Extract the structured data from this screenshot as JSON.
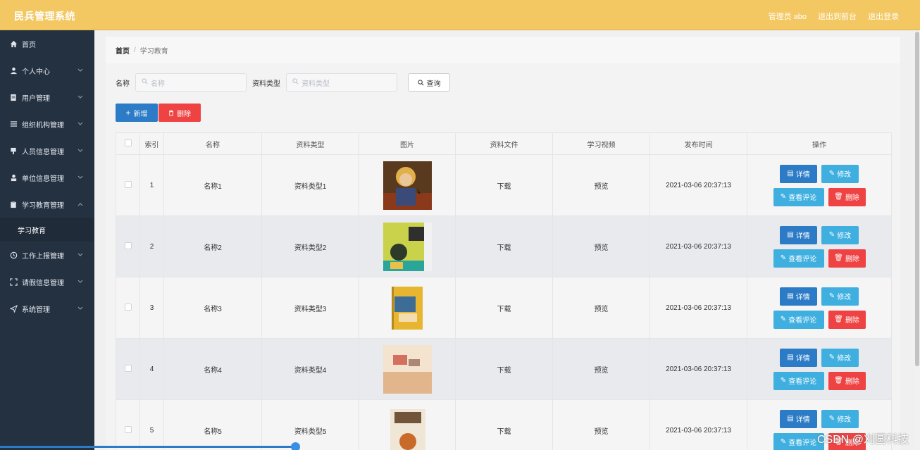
{
  "app": {
    "title": "民兵管理系统"
  },
  "topnav": {
    "admin": "管理员 abo",
    "back": "退出到前台",
    "logout": "退出登录"
  },
  "sidebar": {
    "items": [
      {
        "label": "首页",
        "icon": "home-icon"
      },
      {
        "label": "个人中心",
        "icon": "user-icon"
      },
      {
        "label": "用户管理",
        "icon": "document-icon"
      },
      {
        "label": "组织机构管理",
        "icon": "list-icon"
      },
      {
        "label": "人员信息管理",
        "icon": "badge-icon"
      },
      {
        "label": "单位信息管理",
        "icon": "person-icon"
      },
      {
        "label": "学习教育管理",
        "icon": "clipboard-icon"
      },
      {
        "label": "工作上报管理",
        "icon": "clock-icon"
      },
      {
        "label": "请假信息管理",
        "icon": "frame-icon"
      },
      {
        "label": "系统管理",
        "icon": "send-icon"
      }
    ],
    "sub_active": "学习教育"
  },
  "breadcrumb": {
    "home": "首页",
    "sep": "/",
    "current": "学习教育"
  },
  "filters": {
    "name_label": "名称",
    "name_placeholder": "名称",
    "type_label": "资料类型",
    "type_placeholder": "资料类型",
    "query": "查询"
  },
  "actions": {
    "add": "新增",
    "delete": "删除"
  },
  "table": {
    "headers": [
      "索引",
      "名称",
      "资料类型",
      "图片",
      "资料文件",
      "学习视频",
      "发布时间",
      "操作"
    ],
    "rows": [
      {
        "index": "1",
        "name": "名称1",
        "type": "资料类型1",
        "file": "下载",
        "video": "预览",
        "time": "2021-03-06 20:37:13"
      },
      {
        "index": "2",
        "name": "名称2",
        "type": "资料类型2",
        "file": "下载",
        "video": "预览",
        "time": "2021-03-06 20:37:13"
      },
      {
        "index": "3",
        "name": "名称3",
        "type": "资料类型3",
        "file": "下载",
        "video": "预览",
        "time": "2021-03-06 20:37:13"
      },
      {
        "index": "4",
        "name": "名称4",
        "type": "资料类型4",
        "file": "下载",
        "video": "预览",
        "time": "2021-03-06 20:37:13"
      },
      {
        "index": "5",
        "name": "名称5",
        "type": "资料类型5",
        "file": "下载",
        "video": "预览",
        "time": "2021-03-06 20:37:13"
      }
    ],
    "op_labels": {
      "detail": "详情",
      "edit": "修改",
      "comment": "查看评论",
      "delete": "删除"
    }
  },
  "watermark": "CSDN @刈圆科技",
  "colors": {
    "header": "#f3c863",
    "sidebar": "#233141",
    "primary": "#2c7bc6",
    "info": "#3fafe0",
    "danger": "#ef4243",
    "link": "#26a269"
  }
}
